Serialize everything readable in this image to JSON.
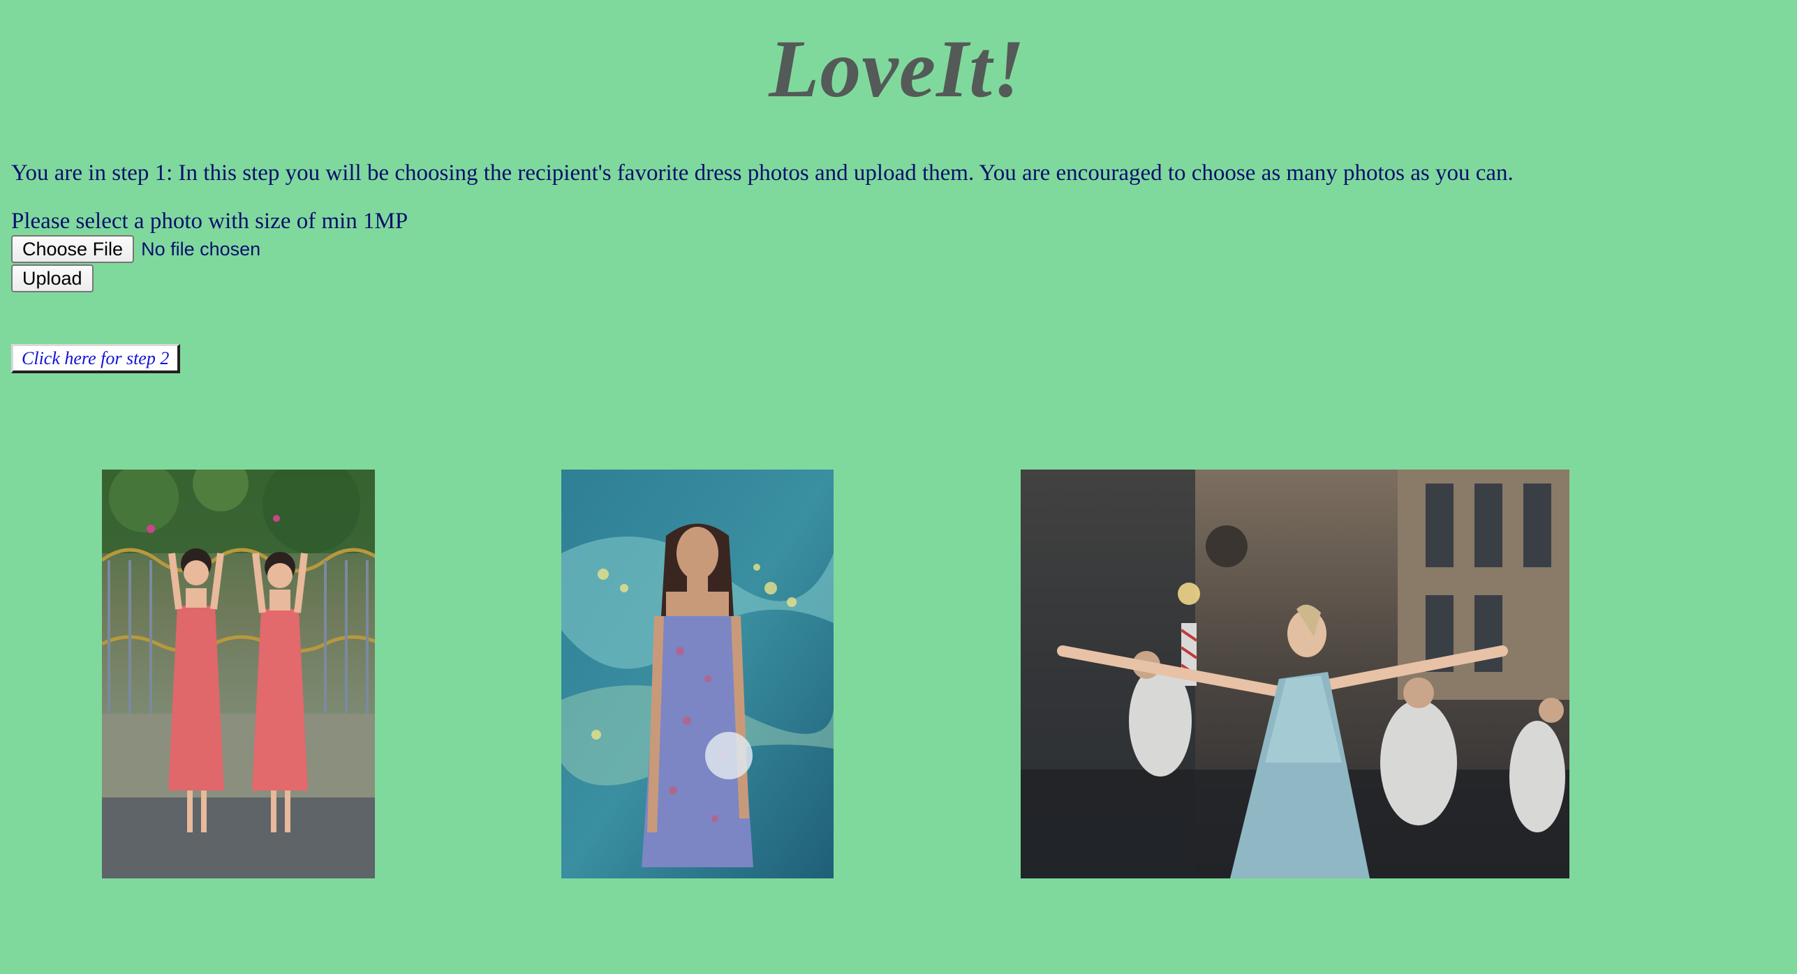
{
  "header": {
    "title": "LoveIt!"
  },
  "step": {
    "instructions": "You are in step 1: In this step you will be choosing the recipient's favorite dress photos and upload them. You are encouraged to choose as many photos as you can."
  },
  "upload": {
    "select_label": "Please select a photo with size of min 1MP",
    "choose_file_label": "Choose File",
    "file_status": "No file chosen",
    "upload_label": "Upload"
  },
  "navigation": {
    "next_step_label": "Click here for step 2"
  },
  "gallery": {
    "photos": [
      {
        "name": "two-women-red-dresses-photo"
      },
      {
        "name": "woman-floral-dress-photo"
      },
      {
        "name": "dancer-blue-dress-photo"
      }
    ]
  },
  "colors": {
    "background": "#80d99c",
    "title": "#545a58",
    "text": "#0a0f6e",
    "link": "#1212d6"
  }
}
